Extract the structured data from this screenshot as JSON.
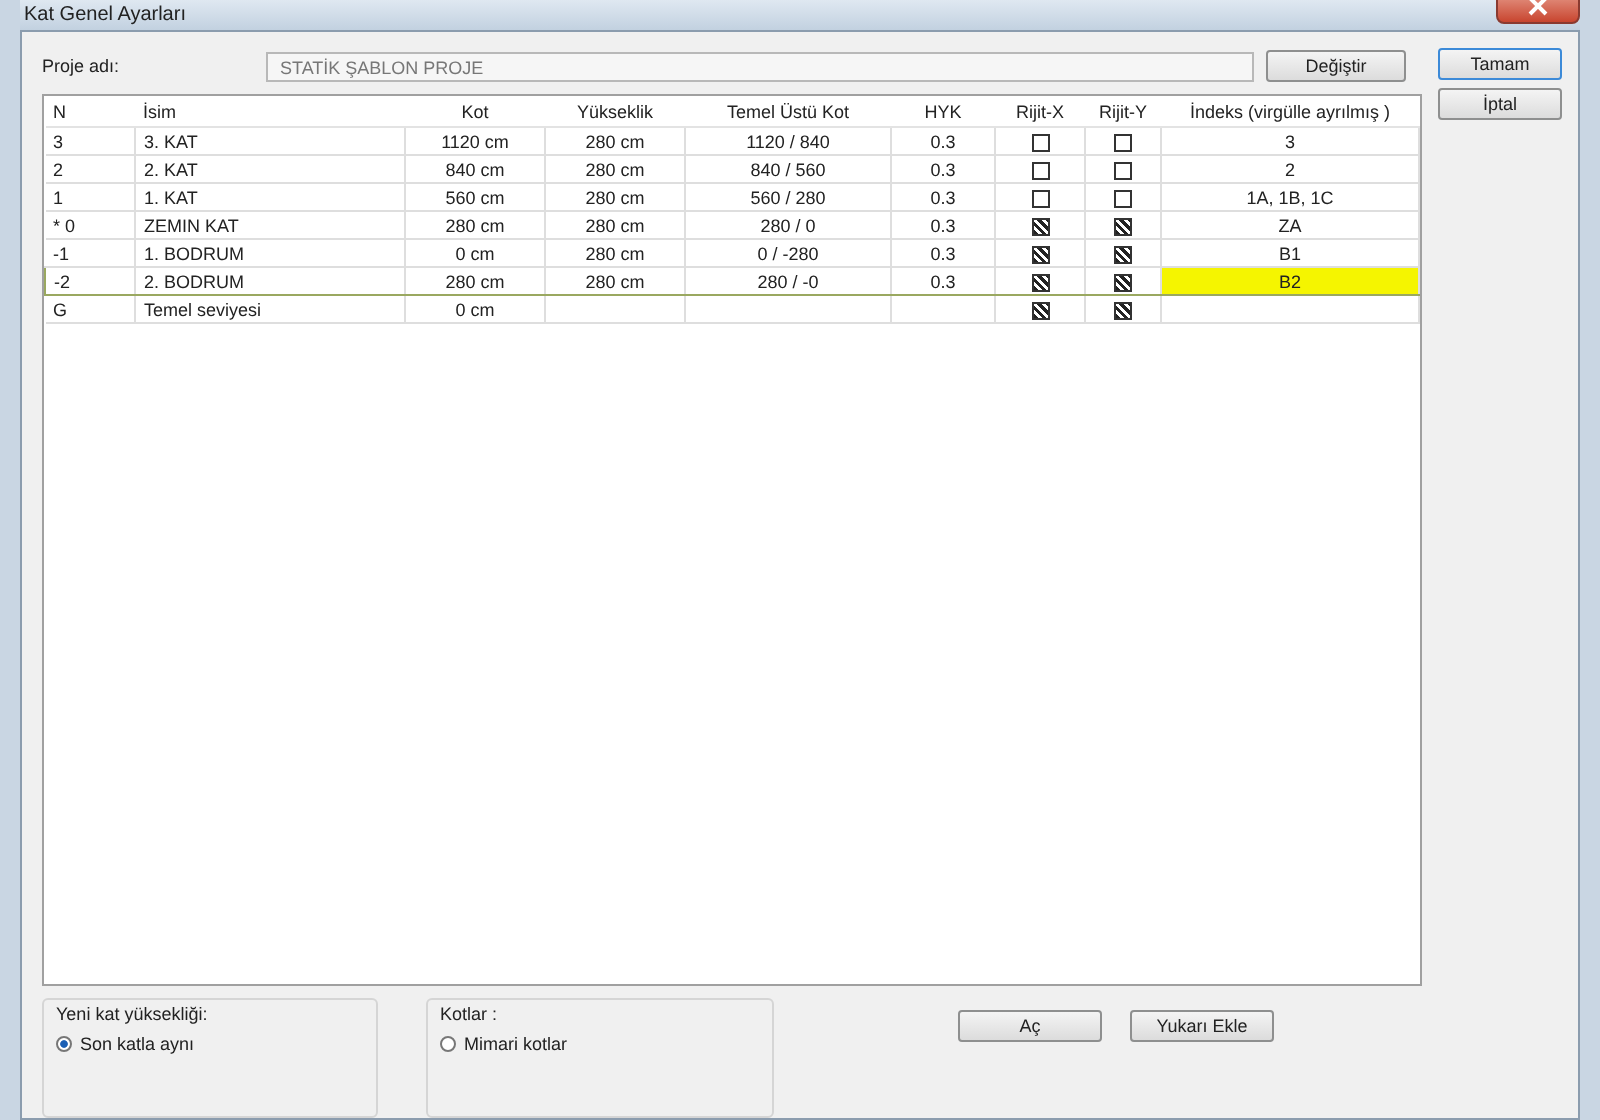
{
  "window": {
    "title": "Kat Genel Ayarları"
  },
  "project": {
    "label": "Proje adı:",
    "value": "STATİK ŞABLON PROJE",
    "change_button": "Değiştir"
  },
  "side_buttons": [
    "Tamam",
    "İptal"
  ],
  "table": {
    "columns": [
      "N",
      "İsim",
      "Kot",
      "Yükseklik",
      "Temel Üstü Kot",
      "HYK",
      "Rijit-X",
      "Rijit-Y",
      "İndeks (virgülle ayrılmış )"
    ],
    "rows": [
      {
        "n": "3",
        "name": "3. KAT",
        "kot": "1120 cm",
        "height": "280 cm",
        "base_kot": "1120 / 840",
        "hyk": "0.3",
        "rigid_x": false,
        "rigid_y": false,
        "index": "3",
        "selected": false
      },
      {
        "n": "2",
        "name": "2. KAT",
        "kot": "840 cm",
        "height": "280 cm",
        "base_kot": "840 / 560",
        "hyk": "0.3",
        "rigid_x": false,
        "rigid_y": false,
        "index": "2",
        "selected": false
      },
      {
        "n": "1",
        "name": "1. KAT",
        "kot": "560 cm",
        "height": "280 cm",
        "base_kot": "560 / 280",
        "hyk": "0.3",
        "rigid_x": false,
        "rigid_y": false,
        "index": "1A, 1B, 1C",
        "selected": false
      },
      {
        "n": "* 0",
        "name": "ZEMIN KAT",
        "kot": "280 cm",
        "height": "280 cm",
        "base_kot": "280 / 0",
        "hyk": "0.3",
        "rigid_x": true,
        "rigid_y": true,
        "index": "ZA",
        "selected": false
      },
      {
        "n": "-1",
        "name": "1. BODRUM",
        "kot": "0 cm",
        "height": "280 cm",
        "base_kot": "0 / -280",
        "hyk": "0.3",
        "rigid_x": true,
        "rigid_y": true,
        "index": "B1",
        "selected": false
      },
      {
        "n": "-2",
        "name": "2. BODRUM",
        "kot": "280 cm",
        "height": "280 cm",
        "base_kot": "280 / -0",
        "hyk": "0.3",
        "rigid_x": true,
        "rigid_y": true,
        "index": "B2",
        "selected": true
      },
      {
        "n": "G",
        "name": "Temel seviyesi",
        "kot": "0 cm",
        "rigid_x": true,
        "rigid_y": true,
        "selected": false
      }
    ]
  },
  "new_floor_height": {
    "title": "Yeni kat yüksekliği:",
    "options": [
      {
        "label": "Son katla aynı",
        "selected": true
      }
    ]
  },
  "levels": {
    "title": "Kotlar :",
    "options": [
      {
        "label": "Mimari kotlar",
        "selected": false
      }
    ]
  },
  "bottom_buttons": [
    "Aç",
    "Yukarı Ekle"
  ]
}
